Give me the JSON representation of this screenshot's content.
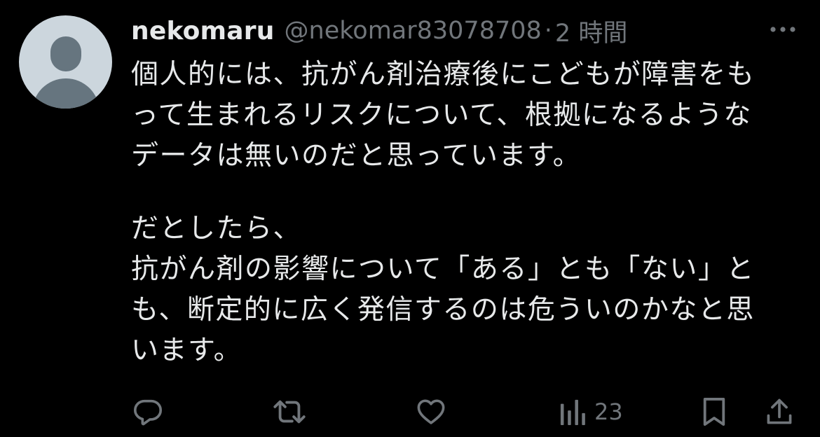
{
  "tweet": {
    "display_name": "nekomaru",
    "handle": "@nekomar83078708",
    "separator": "·",
    "time": "2 時間",
    "text_lines": [
      "個人的には、抗がん剤治療後にこどもが障害をも",
      "って生まれるリスクについて、根拠になるような",
      "データは無いのだと思っています。",
      "",
      "だとしたら、",
      "抗がん剤の影響について「ある」とも「ない」と",
      "も、断定的に広く発信するのは危ういのかなと思",
      "います。"
    ]
  },
  "actions": {
    "reply_icon": "speech-bubble-icon",
    "retweet_icon": "retweet-arrows-icon",
    "like_icon": "heart-icon",
    "views_icon": "bar-chart-icon",
    "views_count": "23",
    "bookmark_icon": "bookmark-icon",
    "share_icon": "share-upload-icon"
  },
  "colors": {
    "background": "#000000",
    "primary_text": "#e7e9ea",
    "secondary_text": "#71767b",
    "avatar_bg": "#ccd6dd",
    "avatar_fg": "#66757f"
  }
}
